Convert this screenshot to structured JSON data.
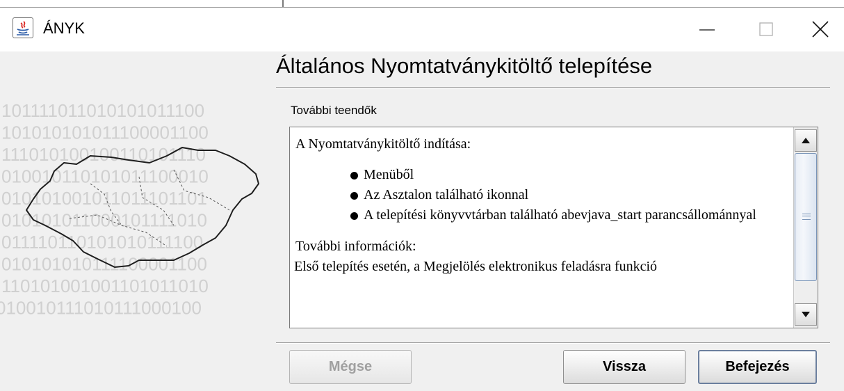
{
  "window": {
    "title": "ÁNYK",
    "controls": {
      "minimize": "minimize",
      "maximize": "maximize",
      "close": "close"
    }
  },
  "side_image": {
    "binary_rows": [
      "101111011010101011100",
      "101010101011100001100",
      "111010100100110101110",
      "010010110101011100010",
      "010101001011011101101",
      "010101011000101111010",
      "011110110101010111100",
      "010101010111100001100",
      "110101001001101011010",
      "010010111010111000100"
    ]
  },
  "main": {
    "heading": "Általános Nyomtatványkitöltő telepítése",
    "group_label": "További teendők",
    "text": {
      "intro": "A Nyomtatványkitöltő indítása:",
      "bullets": [
        "Menüből",
        "Az Asztalon található ikonnal",
        "A telepítési könyvvtárban található abevjava_start parancsállománnyal"
      ],
      "info_heading": "További információk:",
      "cut_line": "Első telepítés esetén, a Megjelölés elektronikus feladásra funkció"
    }
  },
  "buttons": {
    "cancel": "Mégse",
    "back": "Vissza",
    "finish": "Befejezés"
  },
  "colors": {
    "window_bg": "#f0f0f0",
    "button_focus_border": "#6b7f9e",
    "scroll_thumb_border": "#7a95b8"
  }
}
